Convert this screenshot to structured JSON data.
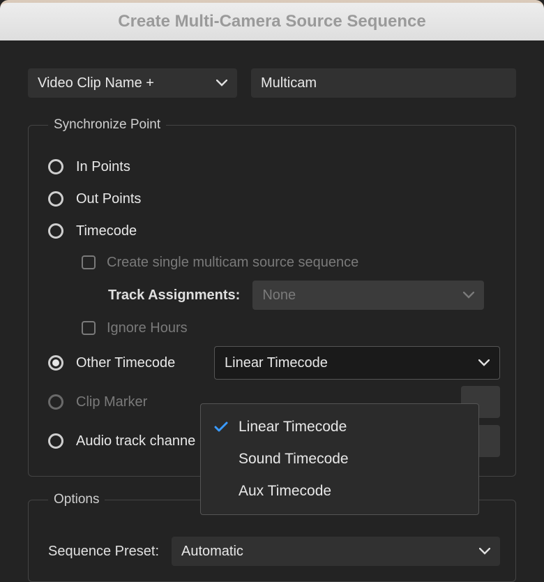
{
  "title": "Create Multi-Camera Source Sequence",
  "name_dropdown": {
    "label": "Video Clip Name +"
  },
  "name_input": {
    "value": "Multicam"
  },
  "sync": {
    "legend": "Synchronize Point",
    "in_points": "In Points",
    "out_points": "Out Points",
    "timecode": "Timecode",
    "create_single": "Create single multicam source sequence",
    "track_assignments_label": "Track Assignments:",
    "track_assignments_value": "None",
    "ignore_hours": "Ignore Hours",
    "other_timecode": "Other Timecode",
    "other_timecode_value": "Linear Timecode",
    "clip_marker": "Clip Marker",
    "audio_track": "Audio track channe"
  },
  "timecode_menu": {
    "items": [
      {
        "label": "Linear Timecode",
        "checked": true
      },
      {
        "label": "Sound Timecode",
        "checked": false
      },
      {
        "label": "Aux Timecode",
        "checked": false
      }
    ]
  },
  "options": {
    "legend": "Options",
    "sequence_preset_label": "Sequence Preset:",
    "sequence_preset_value": "Automatic"
  }
}
